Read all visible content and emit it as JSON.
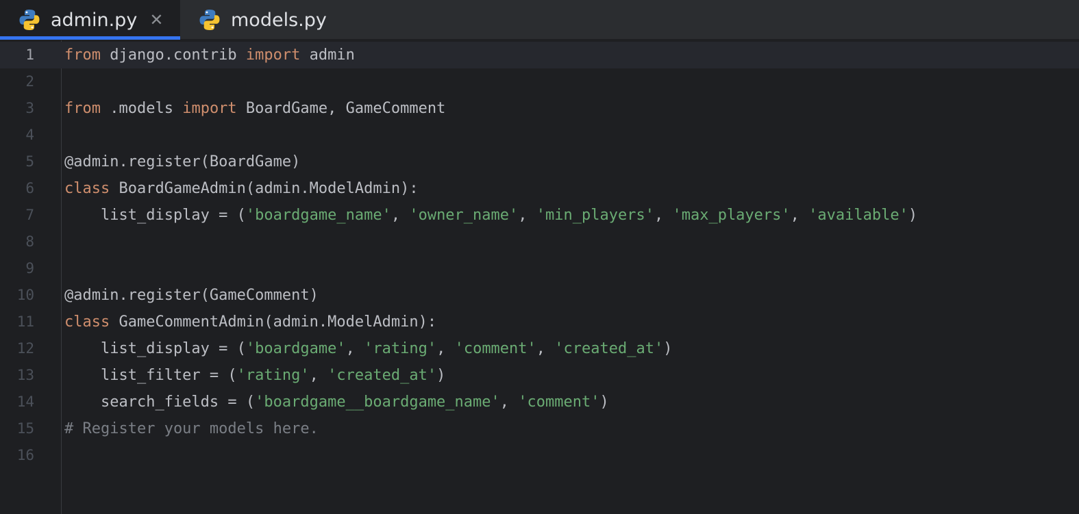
{
  "tabs": [
    {
      "label": "admin.py",
      "icon": "python-icon",
      "active": true,
      "closable": true
    },
    {
      "label": "models.py",
      "icon": "python-icon",
      "active": false
    }
  ],
  "tab_close_glyph": "✕",
  "colors": {
    "keyword": "#cf8e6d",
    "string": "#6aab73",
    "comment": "#7a7e85",
    "text": "#bcbec4",
    "accent": "#3574f0",
    "background": "#1e1f22"
  },
  "editor": {
    "current_line": 1,
    "line_numbers": [
      "1",
      "2",
      "3",
      "4",
      "5",
      "6",
      "7",
      "8",
      "9",
      "10",
      "11",
      "12",
      "13",
      "14",
      "15",
      "16"
    ],
    "lines": [
      [
        {
          "t": "from",
          "c": "kw"
        },
        {
          "t": " django.contrib ",
          "c": ""
        },
        {
          "t": "import",
          "c": "kw"
        },
        {
          "t": " admin",
          "c": ""
        }
      ],
      [],
      [
        {
          "t": "from",
          "c": "kw"
        },
        {
          "t": " .models ",
          "c": ""
        },
        {
          "t": "import",
          "c": "kw"
        },
        {
          "t": " BoardGame, GameComment",
          "c": ""
        }
      ],
      [],
      [
        {
          "t": "@admin.register(BoardGame)",
          "c": "dec"
        }
      ],
      [
        {
          "t": "class",
          "c": "kw"
        },
        {
          "t": " BoardGameAdmin(admin.ModelAdmin):",
          "c": ""
        }
      ],
      [
        {
          "t": "    list_display = (",
          "c": ""
        },
        {
          "t": "'boardgame_name'",
          "c": "str"
        },
        {
          "t": ", ",
          "c": ""
        },
        {
          "t": "'owner_name'",
          "c": "str"
        },
        {
          "t": ", ",
          "c": ""
        },
        {
          "t": "'min_players'",
          "c": "str"
        },
        {
          "t": ", ",
          "c": ""
        },
        {
          "t": "'max_players'",
          "c": "str"
        },
        {
          "t": ", ",
          "c": ""
        },
        {
          "t": "'available'",
          "c": "str"
        },
        {
          "t": ")",
          "c": ""
        }
      ],
      [],
      [],
      [
        {
          "t": "@admin.register(GameComment)",
          "c": "dec"
        }
      ],
      [
        {
          "t": "class",
          "c": "kw"
        },
        {
          "t": " GameCommentAdmin(admin.ModelAdmin):",
          "c": ""
        }
      ],
      [
        {
          "t": "    list_display = (",
          "c": ""
        },
        {
          "t": "'boardgame'",
          "c": "str"
        },
        {
          "t": ", ",
          "c": ""
        },
        {
          "t": "'rating'",
          "c": "str"
        },
        {
          "t": ", ",
          "c": ""
        },
        {
          "t": "'comment'",
          "c": "str"
        },
        {
          "t": ", ",
          "c": ""
        },
        {
          "t": "'created_at'",
          "c": "str"
        },
        {
          "t": ")",
          "c": ""
        }
      ],
      [
        {
          "t": "    list_filter = (",
          "c": ""
        },
        {
          "t": "'rating'",
          "c": "str"
        },
        {
          "t": ", ",
          "c": ""
        },
        {
          "t": "'created_at'",
          "c": "str"
        },
        {
          "t": ")",
          "c": ""
        }
      ],
      [
        {
          "t": "    search_fields = (",
          "c": ""
        },
        {
          "t": "'boardgame__boardgame_name'",
          "c": "str"
        },
        {
          "t": ", ",
          "c": ""
        },
        {
          "t": "'comment'",
          "c": "str"
        },
        {
          "t": ")",
          "c": ""
        }
      ],
      [
        {
          "t": "# Register your models here.",
          "c": "cmt"
        }
      ],
      []
    ]
  }
}
